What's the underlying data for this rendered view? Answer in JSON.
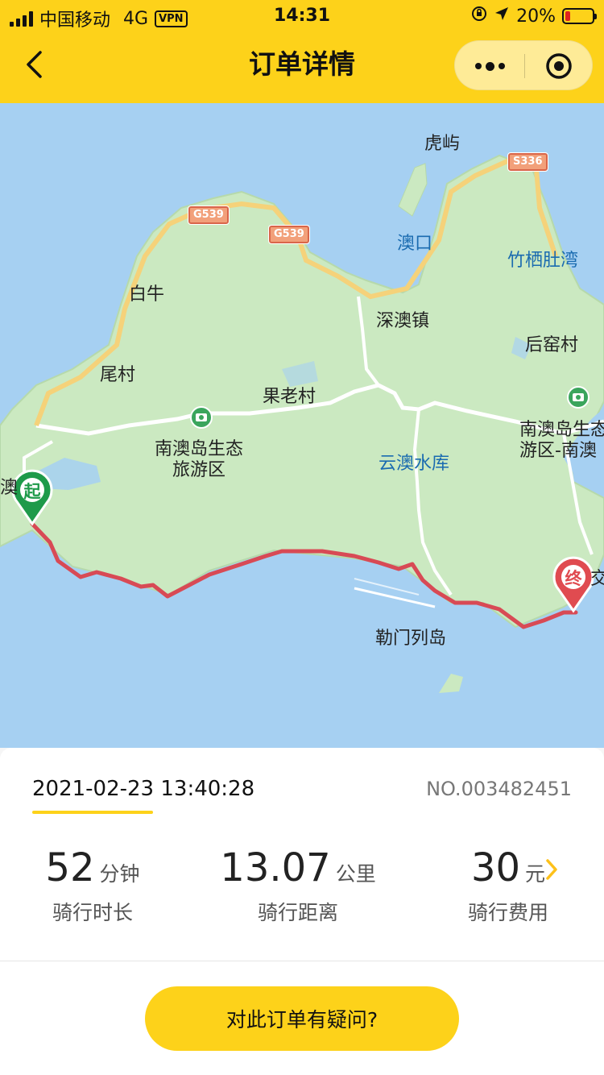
{
  "status_bar": {
    "carrier": "中国移动",
    "network": "4G",
    "vpn": "VPN",
    "time": "14:31",
    "battery_text": "20%",
    "battery_level": 0.2,
    "battery_color": "#e0231f"
  },
  "header": {
    "title": "订单详情",
    "background": "#fdd21a"
  },
  "map": {
    "labels": {
      "huyu": "虎屿",
      "aokou": "澳口",
      "zhuqidu_wan": "竹栖肚湾",
      "bainiu": "白牛",
      "shenao_zhen": "深澳镇",
      "houyao_cun": "后窑村",
      "weicun": "尾村",
      "guolao_cun": "果老村",
      "scenic_west": "南澳岛生态\n旅游区",
      "scenic_east": "南澳岛生态\n游区-南澳",
      "yunao_reservoir": "云澳水库",
      "lemen_islands": "勒门列岛",
      "edge_left": "澳",
      "edge_right": "交"
    },
    "shields": {
      "g539_a": "G539",
      "g539_b": "G539",
      "s336": "S336"
    },
    "start_marker": "起",
    "end_marker": "终",
    "start_color": "#1e9a4a",
    "end_color": "#e04b50",
    "route_color": "#d84a55"
  },
  "order": {
    "datetime": "2021-02-23 13:40:28",
    "number": "NO.003482451"
  },
  "stats": {
    "duration_value": "52",
    "duration_unit": "分钟",
    "duration_label": "骑行时长",
    "distance_value": "13.07",
    "distance_unit": "公里",
    "distance_label": "骑行距离",
    "fee_value": "30",
    "fee_unit": "元",
    "fee_label": "骑行费用"
  },
  "actions": {
    "question_button": "对此订单有疑问?"
  }
}
